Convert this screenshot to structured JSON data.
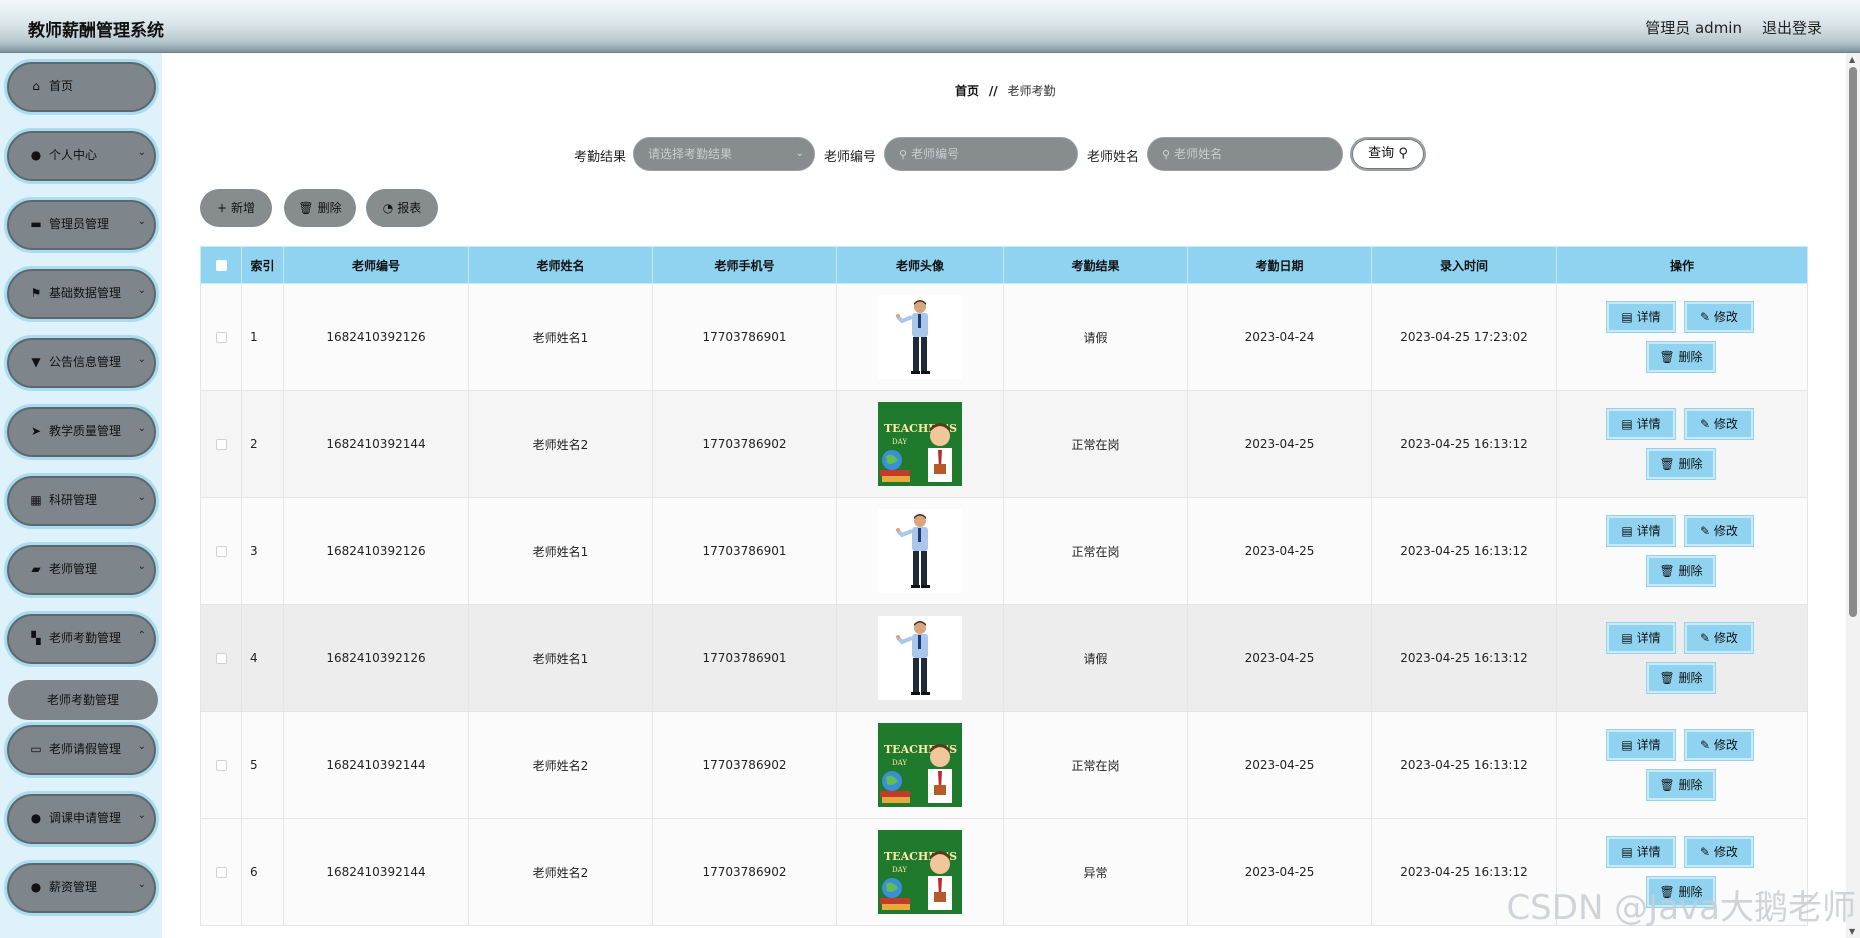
{
  "header": {
    "title": "教师薪酬管理系统",
    "user": "管理员 admin",
    "logout": "退出登录"
  },
  "sidebar": {
    "items": [
      {
        "label": "首页",
        "icon": "home-icon",
        "glyph": "⌂",
        "arrow": ""
      },
      {
        "label": "个人中心",
        "icon": "user-icon",
        "glyph": "●",
        "arrow": "⌄"
      },
      {
        "label": "管理员管理",
        "icon": "card-icon",
        "glyph": "▬",
        "arrow": "⌄"
      },
      {
        "label": "基础数据管理",
        "icon": "flag-icon",
        "glyph": "⚑",
        "arrow": "⌄"
      },
      {
        "label": "公告信息管理",
        "icon": "pin-icon",
        "glyph": "▼",
        "arrow": "⌄"
      },
      {
        "label": "教学质量管理",
        "icon": "send-icon",
        "glyph": "➤",
        "arrow": "⌄"
      },
      {
        "label": "科研管理",
        "icon": "calendar-icon",
        "glyph": "▦",
        "arrow": "⌄"
      },
      {
        "label": "老师管理",
        "icon": "briefcase-icon",
        "glyph": "▰",
        "arrow": "⌄"
      },
      {
        "label": "老师考勤管理",
        "icon": "grid-icon",
        "glyph": "▚",
        "arrow": "⌃"
      },
      {
        "label": "老师请假管理",
        "icon": "monitor-icon",
        "glyph": "▭",
        "arrow": "⌄"
      },
      {
        "label": "调课申请管理",
        "icon": "user-icon",
        "glyph": "●",
        "arrow": "⌄"
      },
      {
        "label": "薪资管理",
        "icon": "user-icon",
        "glyph": "●",
        "arrow": "⌄"
      }
    ],
    "sub_item": "老师考勤管理"
  },
  "breadcrumb": {
    "home": "首页",
    "sep": "//",
    "current": "老师考勤"
  },
  "search": {
    "result_label": "考勤结果",
    "result_placeholder": "请选择考勤结果",
    "id_label": "老师编号",
    "id_placeholder": "老师编号",
    "name_label": "老师姓名",
    "name_placeholder": "老师姓名",
    "query_button": "查询"
  },
  "actions": {
    "add": "新增",
    "delete": "删除",
    "report": "报表"
  },
  "table": {
    "headers": [
      "索引",
      "老师编号",
      "老师姓名",
      "老师手机号",
      "老师头像",
      "考勤结果",
      "考勤日期",
      "录入时间",
      "操作"
    ],
    "rows": [
      {
        "idx": "1",
        "teacher_no": "1682410392126",
        "name": "老师姓名1",
        "phone": "17703786901",
        "avatar": "teacher-photo-man",
        "result": "请假",
        "date": "2023-04-24",
        "created": "2023-04-25 17:23:02"
      },
      {
        "idx": "2",
        "teacher_no": "1682410392144",
        "name": "老师姓名2",
        "phone": "17703786902",
        "avatar": "teachers-day-poster",
        "result": "正常在岗",
        "date": "2023-04-25",
        "created": "2023-04-25 16:13:12"
      },
      {
        "idx": "3",
        "teacher_no": "1682410392126",
        "name": "老师姓名1",
        "phone": "17703786901",
        "avatar": "teacher-photo-man",
        "result": "正常在岗",
        "date": "2023-04-25",
        "created": "2023-04-25 16:13:12"
      },
      {
        "idx": "4",
        "teacher_no": "1682410392126",
        "name": "老师姓名1",
        "phone": "17703786901",
        "avatar": "teacher-photo-man",
        "result": "请假",
        "date": "2023-04-25",
        "created": "2023-04-25 16:13:12"
      },
      {
        "idx": "5",
        "teacher_no": "1682410392144",
        "name": "老师姓名2",
        "phone": "17703786902",
        "avatar": "teachers-day-poster",
        "result": "正常在岗",
        "date": "2023-04-25",
        "created": "2023-04-25 16:13:12"
      },
      {
        "idx": "6",
        "teacher_no": "1682410392144",
        "name": "老师姓名2",
        "phone": "17703786902",
        "avatar": "teachers-day-poster",
        "result": "异常",
        "date": "2023-04-25",
        "created": "2023-04-25 16:13:12"
      }
    ],
    "op_labels": {
      "detail": "详情",
      "edit": "修改",
      "delete": "删除"
    }
  },
  "watermark": "CSDN @Java大鹅老师",
  "colors": {
    "header_bg": "#b8c8d0",
    "sidebar_bg": "#dff1fa",
    "menu_item": "#7e868b",
    "accent": "#8fd3f0"
  }
}
